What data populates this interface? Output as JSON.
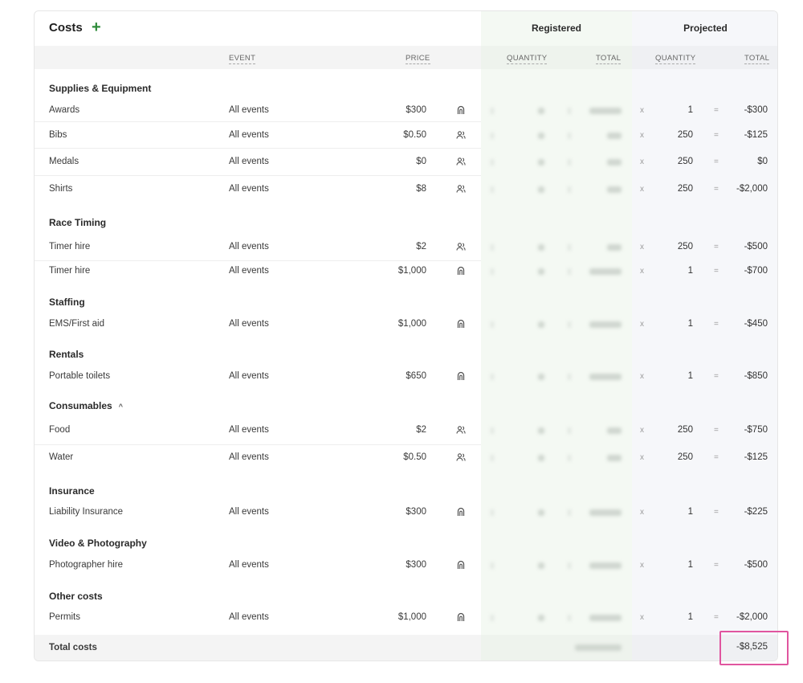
{
  "header": {
    "title": "Costs",
    "add_label": "+",
    "registered_label": "Registered",
    "projected_label": "Projected"
  },
  "columns": {
    "event": "EVENT",
    "price": "PRICE",
    "reg_quantity": "QUANTITY",
    "reg_total": "TOTAL",
    "proj_quantity": "QUANTITY",
    "proj_total": "TOTAL"
  },
  "sections": [
    {
      "title": "Supplies & Equipment"
    },
    {
      "title": "Race Timing"
    },
    {
      "title": "Staffing"
    },
    {
      "title": "Rentals"
    },
    {
      "title": "Consumables",
      "toggle": "^"
    },
    {
      "title": "Insurance"
    },
    {
      "title": "Video & Photography"
    },
    {
      "title": "Other costs"
    }
  ],
  "rows": [
    {
      "name": "Awards",
      "event": "All events",
      "price": "$300",
      "icon": "flat-fee-icon",
      "mult": "x",
      "qty": "1",
      "eq": "=",
      "total": "-$300"
    },
    {
      "name": "Bibs",
      "event": "All events",
      "price": "$0.50",
      "icon": "per-person-icon",
      "mult": "x",
      "qty": "250",
      "eq": "=",
      "total": "-$125"
    },
    {
      "name": "Medals",
      "event": "All events",
      "price": "$0",
      "icon": "per-person-icon",
      "mult": "x",
      "qty": "250",
      "eq": "=",
      "total": "$0"
    },
    {
      "name": "Shirts",
      "event": "All events",
      "price": "$8",
      "icon": "per-person-icon",
      "mult": "x",
      "qty": "250",
      "eq": "=",
      "total": "-$2,000"
    },
    {
      "name": "Timer hire",
      "event": "All events",
      "price": "$2",
      "icon": "per-person-icon",
      "mult": "x",
      "qty": "250",
      "eq": "=",
      "total": "-$500"
    },
    {
      "name": "Timer hire",
      "event": "All events",
      "price": "$1,000",
      "icon": "flat-fee-icon",
      "mult": "x",
      "qty": "1",
      "eq": "=",
      "total": "-$700"
    },
    {
      "name": "EMS/First aid",
      "event": "All events",
      "price": "$1,000",
      "icon": "flat-fee-icon",
      "mult": "x",
      "qty": "1",
      "eq": "=",
      "total": "-$450"
    },
    {
      "name": "Portable toilets",
      "event": "All events",
      "price": "$650",
      "icon": "flat-fee-icon",
      "mult": "x",
      "qty": "1",
      "eq": "=",
      "total": "-$850"
    },
    {
      "name": "Food",
      "event": "All events",
      "price": "$2",
      "icon": "per-person-icon",
      "mult": "x",
      "qty": "250",
      "eq": "=",
      "total": "-$750"
    },
    {
      "name": "Water",
      "event": "All events",
      "price": "$0.50",
      "icon": "per-person-icon",
      "mult": "x",
      "qty": "250",
      "eq": "=",
      "total": "-$125"
    },
    {
      "name": "Liability Insurance",
      "event": "All events",
      "price": "$300",
      "icon": "flat-fee-icon",
      "mult": "x",
      "qty": "1",
      "eq": "=",
      "total": "-$225"
    },
    {
      "name": "Photographer hire",
      "event": "All events",
      "price": "$300",
      "icon": "flat-fee-icon",
      "mult": "x",
      "qty": "1",
      "eq": "=",
      "total": "-$500"
    },
    {
      "name": "Permits",
      "event": "All events",
      "price": "$1,000",
      "icon": "flat-fee-icon",
      "mult": "x",
      "qty": "1",
      "eq": "=",
      "total": "-$2,000"
    }
  ],
  "footer": {
    "label": "Total costs",
    "grand_total": "-$8,525"
  },
  "colors": {
    "accent": "#2e8b3a",
    "registered_bg": "#f4f9f3",
    "projected_bg": "#f6f7fa",
    "highlight": "#e0559f"
  }
}
